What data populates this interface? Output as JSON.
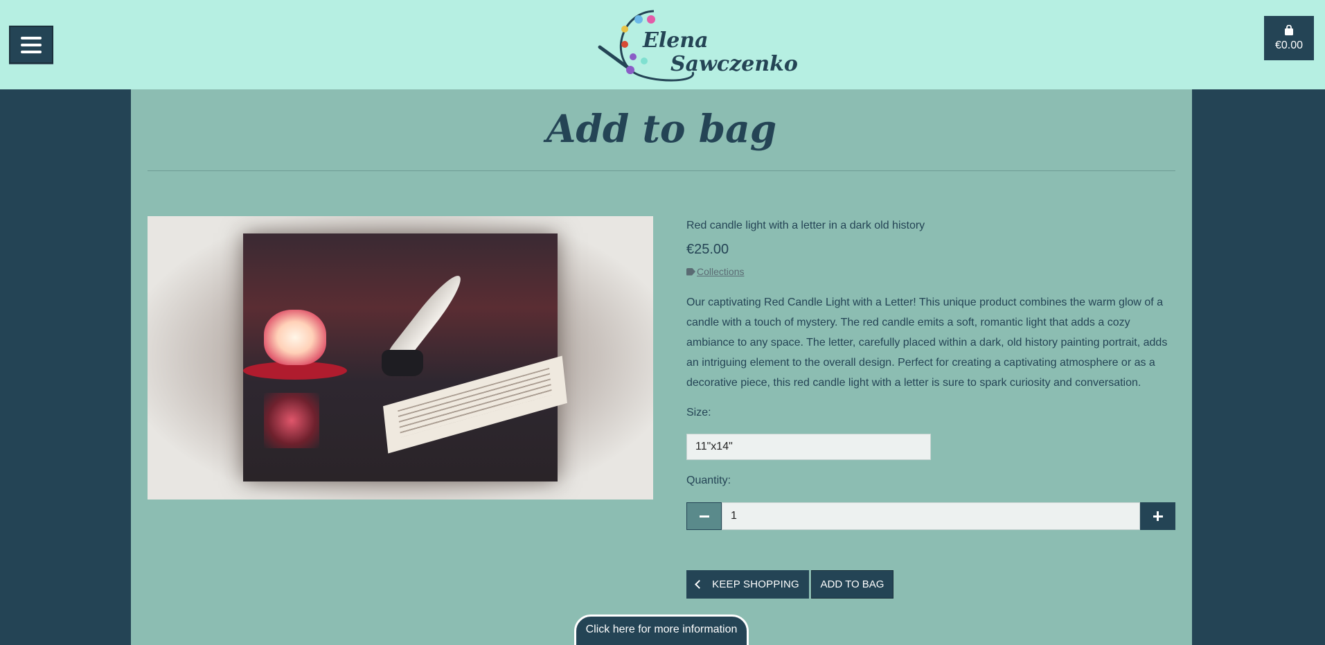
{
  "header": {
    "menu_icon": "hamburger-menu-icon",
    "logo": {
      "first_name": "Elena",
      "last_name": "Sawczenko",
      "palette_dots": [
        "#6bb8e8",
        "#e35ba8",
        "#e8c245",
        "#d84a34",
        "#8a5cc6",
        "#7fe0d0"
      ]
    },
    "bag": {
      "icon": "shopping-bag-icon",
      "total": "€0.00"
    }
  },
  "page": {
    "title": "Add to bag"
  },
  "product": {
    "name": "Red candle light with a letter in a dark old history",
    "price": "€25.00",
    "category_icon": "tag-icon",
    "category": "Collections",
    "description": "Our captivating Red Candle Light with a Letter! This unique product combines the warm glow of a candle with a touch of mystery. The red candle emits a soft, romantic light that adds a cozy ambiance to any space. The letter, carefully placed within a dark, old history painting portrait, adds an intriguing element to the overall design. Perfect for creating a captivating atmosphere or as a decorative piece, this red candle light with a letter is sure to spark curiosity and conversation."
  },
  "form": {
    "size_label": "Size:",
    "size_value": "11\"x14\"",
    "quantity_label": "Quantity:",
    "quantity_value": "1",
    "keep_shopping": "KEEP SHOPPING",
    "add_to_bag": "ADD TO BAG"
  },
  "footer_tab": {
    "label": "Click here for more information"
  },
  "colors": {
    "header_bg": "#b6efe2",
    "page_bg": "#244455",
    "main_bg": "#8cbdb2",
    "accent": "#244455"
  }
}
